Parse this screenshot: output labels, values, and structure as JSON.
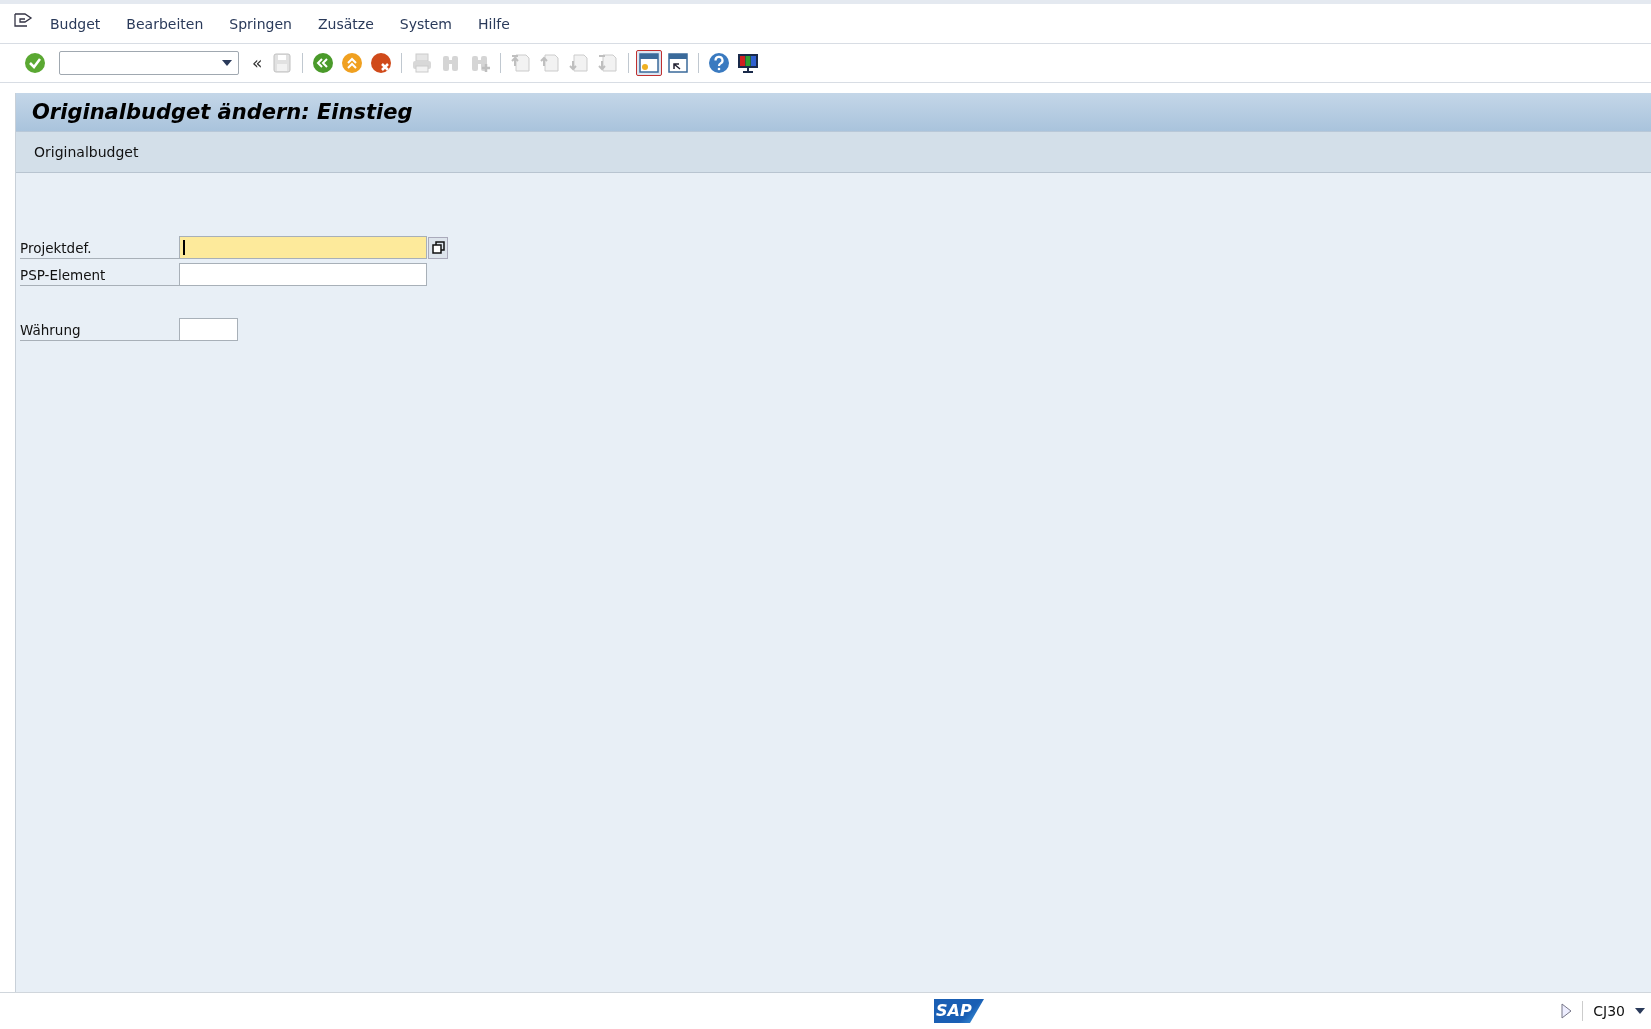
{
  "menu": [
    {
      "label": "Budget"
    },
    {
      "label": "Bearbeiten"
    },
    {
      "label": "Springen"
    },
    {
      "label": "Zusätze"
    },
    {
      "label": "System"
    },
    {
      "label": "Hilfe"
    }
  ],
  "toolbar": [
    {
      "kind": "enter",
      "disabled": false
    },
    {
      "kind": "command"
    },
    {
      "kind": "collapse",
      "text": "«"
    },
    {
      "kind": "save",
      "disabled": true
    },
    {
      "kind": "sep"
    },
    {
      "kind": "back",
      "disabled": false
    },
    {
      "kind": "exit",
      "disabled": false
    },
    {
      "kind": "cancel",
      "disabled": false
    },
    {
      "kind": "sep"
    },
    {
      "kind": "print",
      "disabled": true
    },
    {
      "kind": "find",
      "disabled": true
    },
    {
      "kind": "findnext",
      "disabled": true
    },
    {
      "kind": "sep"
    },
    {
      "kind": "first",
      "disabled": true
    },
    {
      "kind": "prev",
      "disabled": true
    },
    {
      "kind": "next",
      "disabled": true
    },
    {
      "kind": "last",
      "disabled": true
    },
    {
      "kind": "sep"
    },
    {
      "kind": "newsession",
      "disabled": false,
      "selected": true
    },
    {
      "kind": "shortcut",
      "disabled": false,
      "selected": false
    },
    {
      "kind": "sep"
    },
    {
      "kind": "help",
      "disabled": false
    },
    {
      "kind": "layout",
      "disabled": false
    }
  ],
  "title": "Originalbudget ändern: Einstieg",
  "app_toolbar": [
    {
      "label": "Originalbudget"
    }
  ],
  "fields": [
    {
      "label": "Projektdef.",
      "kind": "object",
      "required": true,
      "focused": true,
      "value_help": true
    },
    {
      "label": "PSP-Element",
      "kind": "object",
      "required": false,
      "focused": false,
      "value_help": false
    },
    {
      "label": "Währung",
      "kind": "currency",
      "required": false,
      "focused": false,
      "value_help": false
    }
  ],
  "status_bar": {
    "logo": "SAP",
    "transaction": "CJ30"
  }
}
